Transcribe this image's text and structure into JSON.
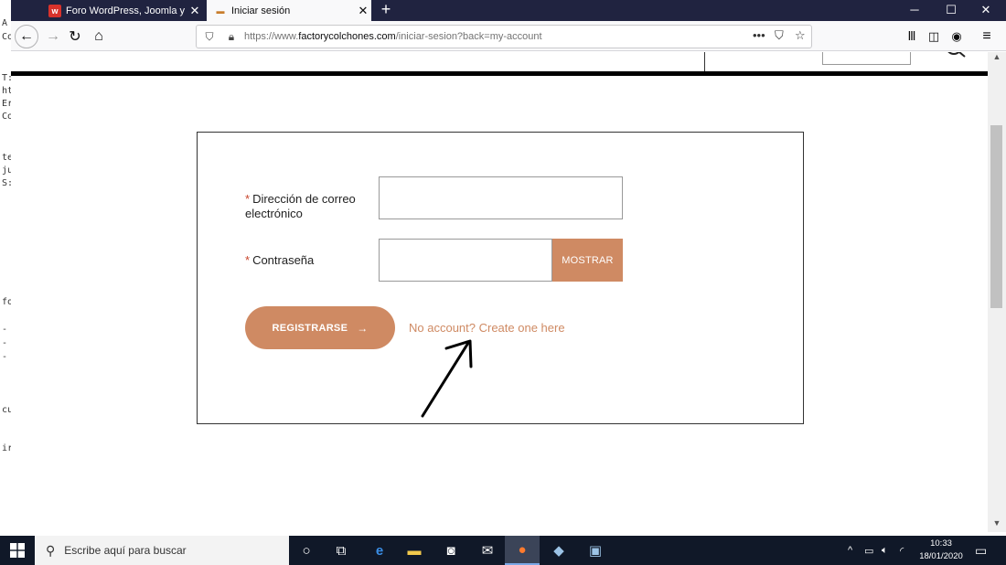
{
  "browser": {
    "tabs": [
      {
        "title": "Foro WordPress, Joomla y Prest",
        "icon": "forum-logo-icon"
      },
      {
        "title": "Iniciar sesión",
        "icon": "bed-icon"
      }
    ],
    "url_prefix": "https://www.",
    "url_domain": "factorycolchones.com",
    "url_path": "/iniciar-sesion?back=my-account",
    "new_tab": "+",
    "page_actions": "•••"
  },
  "login_form": {
    "email_label_required": "*",
    "email_label": "Dirección de correo electrónico",
    "email_value": "",
    "password_label_required": "*",
    "password_label": "Contraseña",
    "password_value": "",
    "show_button": "MOSTRAR",
    "register_button": "REGISTRARSE",
    "register_arrow": "→",
    "create_account_link": "No account? Create one here"
  },
  "taskbar": {
    "search_placeholder": "Escribe aquí para buscar",
    "time": "10:33",
    "date": "18/01/2020"
  },
  "background_editor": {
    "lines": [
      "A",
      "Co",
      "T:",
      "ht",
      "Er",
      "Co",
      "te",
      "ju",
      "S:",
      "fo",
      "-",
      "-",
      "-",
      "cu",
      "ir"
    ]
  },
  "colors": {
    "accent": "#cf8a63",
    "tabbar": "#202340",
    "taskbar": "#101828"
  }
}
